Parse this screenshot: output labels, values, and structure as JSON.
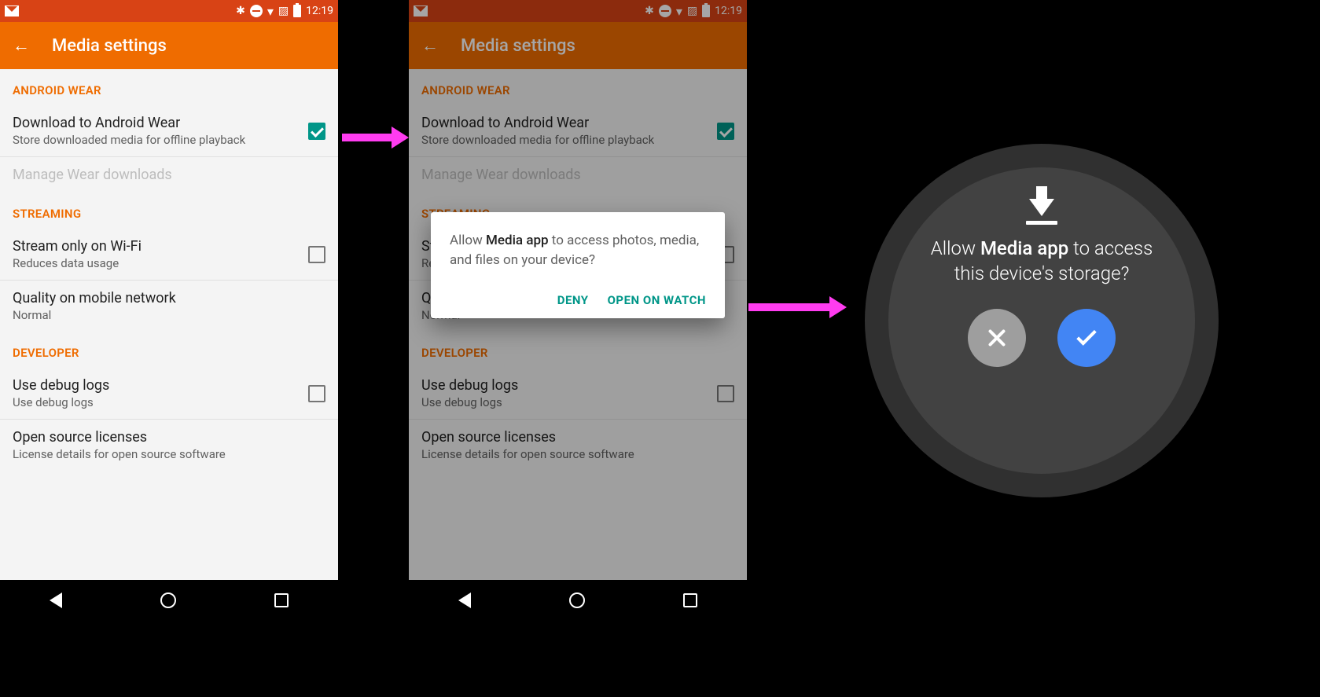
{
  "status": {
    "time": "12:19"
  },
  "header": {
    "title": "Media settings"
  },
  "sections": {
    "wear": {
      "title": "ANDROID WEAR",
      "download": {
        "title": "Download to Android Wear",
        "sub": "Store downloaded media for offline playback",
        "checked": true
      },
      "manage": {
        "title": "Manage Wear downloads"
      }
    },
    "streaming": {
      "title": "STREAMING",
      "wifi": {
        "title": "Stream only on Wi-Fi",
        "sub": "Reduces data usage",
        "checked": false
      },
      "quality": {
        "title": "Quality on mobile network",
        "sub": "Normal"
      }
    },
    "developer": {
      "title": "DEVELOPER",
      "debug": {
        "title": "Use debug logs",
        "sub": "Use debug logs",
        "checked": false
      },
      "oss": {
        "title": "Open source licenses",
        "sub": "License details for open source software"
      }
    }
  },
  "dialog": {
    "prefix": "Allow ",
    "app_name": "Media app",
    "suffix": " to access photos, media, and files on your device?",
    "deny": "DENY",
    "open": "OPEN ON WATCH"
  },
  "watch": {
    "prefix": "Allow ",
    "app_name": "Media app",
    "suffix": " to access this device's storage?"
  }
}
